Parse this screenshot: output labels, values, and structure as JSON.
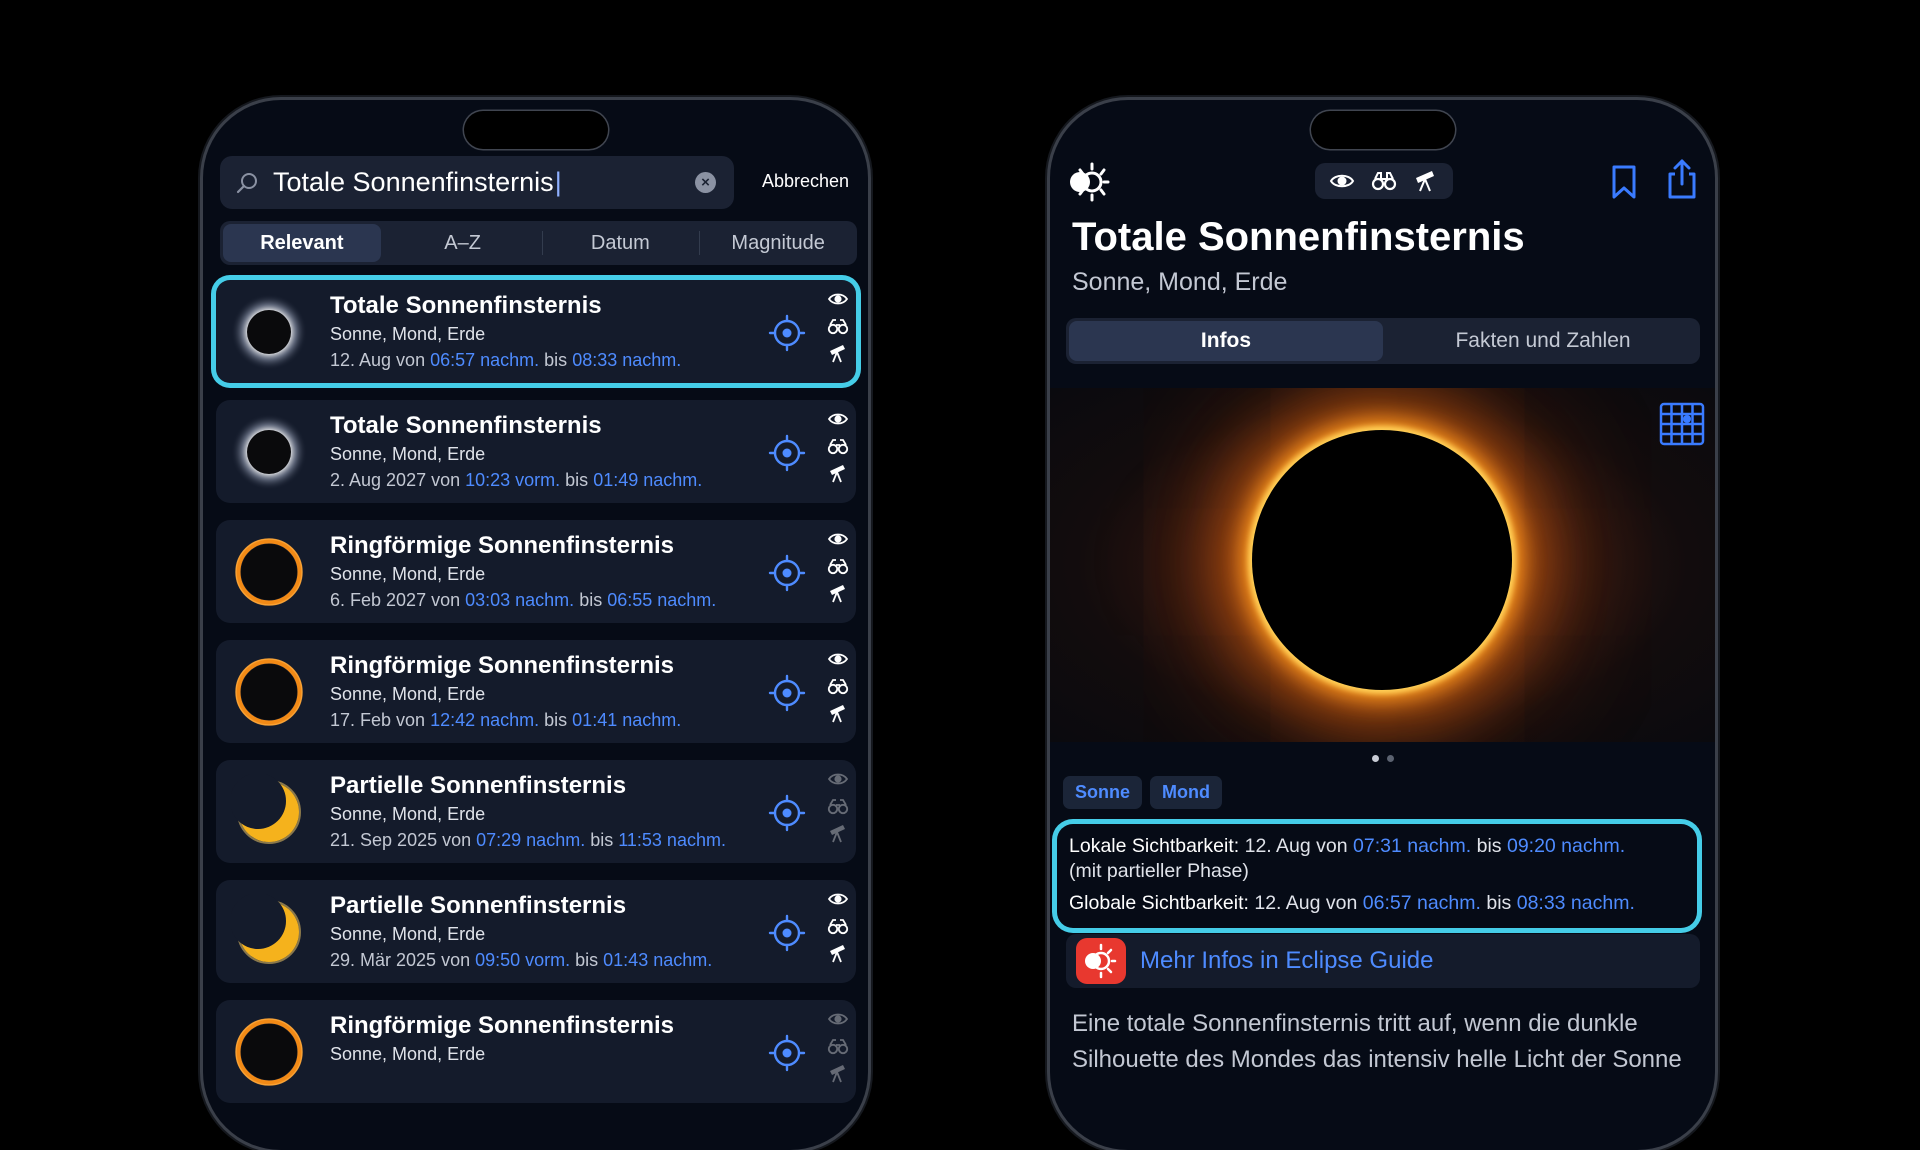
{
  "left": {
    "search": {
      "query": "Totale Sonnenfinsternis",
      "cancel_label": "Abbrechen"
    },
    "segments": [
      "Relevant",
      "A–Z",
      "Datum",
      "Magnitude"
    ],
    "results": [
      {
        "title": "Totale Sonnenfinsternis",
        "subtitle": "Sonne, Mond, Erde",
        "date_prefix": "12. Aug von ",
        "start": "06:57 nachm.",
        "sep": " bis ",
        "end": "08:33 nachm.",
        "type": "total",
        "vis_dim": false,
        "selected": true
      },
      {
        "title": "Totale Sonnenfinsternis",
        "subtitle": "Sonne, Mond, Erde",
        "date_prefix": "2. Aug 2027 von ",
        "start": "10:23 vorm.",
        "sep": " bis ",
        "end": "01:49 nachm.",
        "type": "total",
        "vis_dim": false,
        "selected": false
      },
      {
        "title": "Ringförmige Sonnenfinsternis",
        "subtitle": "Sonne, Mond, Erde",
        "date_prefix": "6. Feb 2027 von ",
        "start": "03:03 nachm.",
        "sep": " bis ",
        "end": "06:55 nachm.",
        "type": "annular",
        "vis_dim": false,
        "selected": false
      },
      {
        "title": "Ringförmige Sonnenfinsternis",
        "subtitle": "Sonne, Mond, Erde",
        "date_prefix": "17. Feb von ",
        "start": "12:42 nachm.",
        "sep": " bis ",
        "end": "01:41 nachm.",
        "type": "annular",
        "vis_dim": false,
        "selected": false
      },
      {
        "title": "Partielle Sonnenfinsternis",
        "subtitle": "Sonne, Mond, Erde",
        "date_prefix": "21. Sep 2025 von ",
        "start": "07:29 nachm.",
        "sep": " bis ",
        "end": "11:53 nachm.",
        "type": "partial",
        "vis_dim": true,
        "selected": false
      },
      {
        "title": "Partielle Sonnenfinsternis",
        "subtitle": "Sonne, Mond, Erde",
        "date_prefix": "29. Mär 2025 von ",
        "start": "09:50 vorm.",
        "sep": " bis ",
        "end": "01:43 nachm.",
        "type": "partial",
        "vis_dim": false,
        "selected": false
      },
      {
        "title": "Ringförmige Sonnenfinsternis",
        "subtitle": "Sonne, Mond, Erde",
        "date_prefix": "",
        "start": "",
        "sep": "",
        "end": "",
        "type": "annular",
        "vis_dim": true,
        "selected": false
      }
    ]
  },
  "right": {
    "title": "Totale Sonnenfinsternis",
    "subtitle": "Sonne, Mond, Erde",
    "tabs": [
      "Infos",
      "Fakten und Zahlen"
    ],
    "chips": [
      "Sonne",
      "Mond"
    ],
    "local_label": "Lokale Sichtbarkeit:",
    "local_prefix": " 12. Aug von ",
    "local_start": "07:31 nachm.",
    "local_sep": " bis ",
    "local_end": "09:20 nachm.",
    "local_note": "(mit partieller Phase)",
    "global_label": "Globale Sichtbarkeit:",
    "global_prefix": " 12. Aug von ",
    "global_start": "06:57 nachm.",
    "global_sep": " bis ",
    "global_end": "08:33 nachm.",
    "guide_link": "Mehr Infos in Eclipse Guide",
    "description": "Eine totale Sonnenfinsternis tritt auf, wenn die dunkle Silhouette des Mondes das intensiv helle Licht der Sonne"
  },
  "colors": {
    "accent": "#4e8bff",
    "highlight": "#45cde8",
    "panel": "#141b2b",
    "background": "#060b16"
  }
}
